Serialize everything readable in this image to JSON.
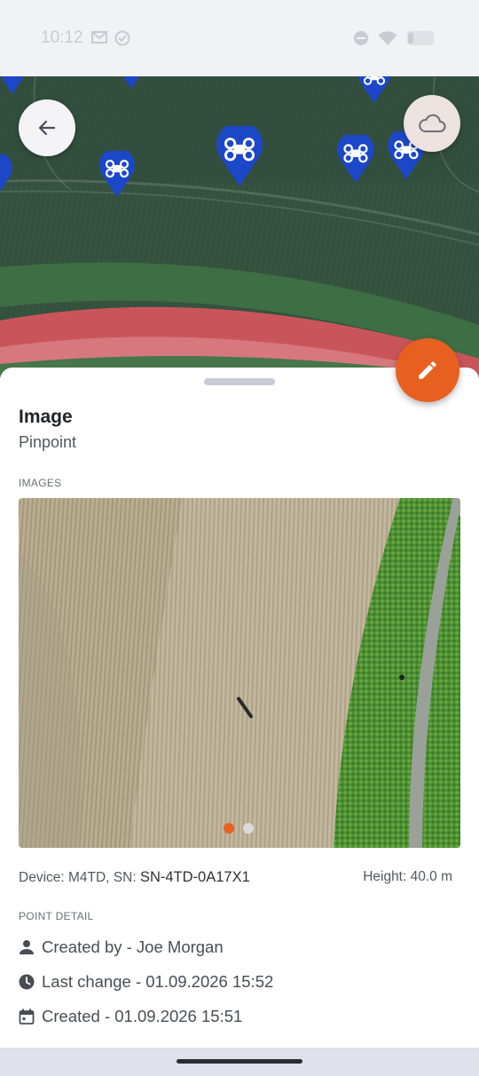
{
  "status_bar": {
    "time": "10:12",
    "left_icons": [
      "gmail-icon",
      "check-circle-icon"
    ],
    "right_icons": [
      "dnd-icon",
      "wifi-icon",
      "battery-icon"
    ]
  },
  "map": {
    "back_icon": "arrow-left-icon",
    "cloud_icon": "cloud-icon",
    "marker_icon": "drone-icon"
  },
  "sheet": {
    "title": "Image",
    "subtitle": "Pinpoint",
    "edit_icon": "pencil-icon",
    "images_label": "IMAGES",
    "image_count": 2,
    "active_image_index": 0,
    "device_text": "Device: M4TD, SN:",
    "serial_number": "SN-4TD-0A17X1",
    "height_text": "Height: 40.0 m",
    "point_detail_label": "POINT DETAIL",
    "created_by": "Created by - Joe Morgan",
    "last_change": "Last change - 01.09.2026 15:52",
    "created": "Created - 01.09.2026 15:51"
  },
  "colors": {
    "accent": "#e8601f",
    "marker": "#1c47c9",
    "title": "#23242a",
    "dot_inactive": "#d9dade"
  }
}
